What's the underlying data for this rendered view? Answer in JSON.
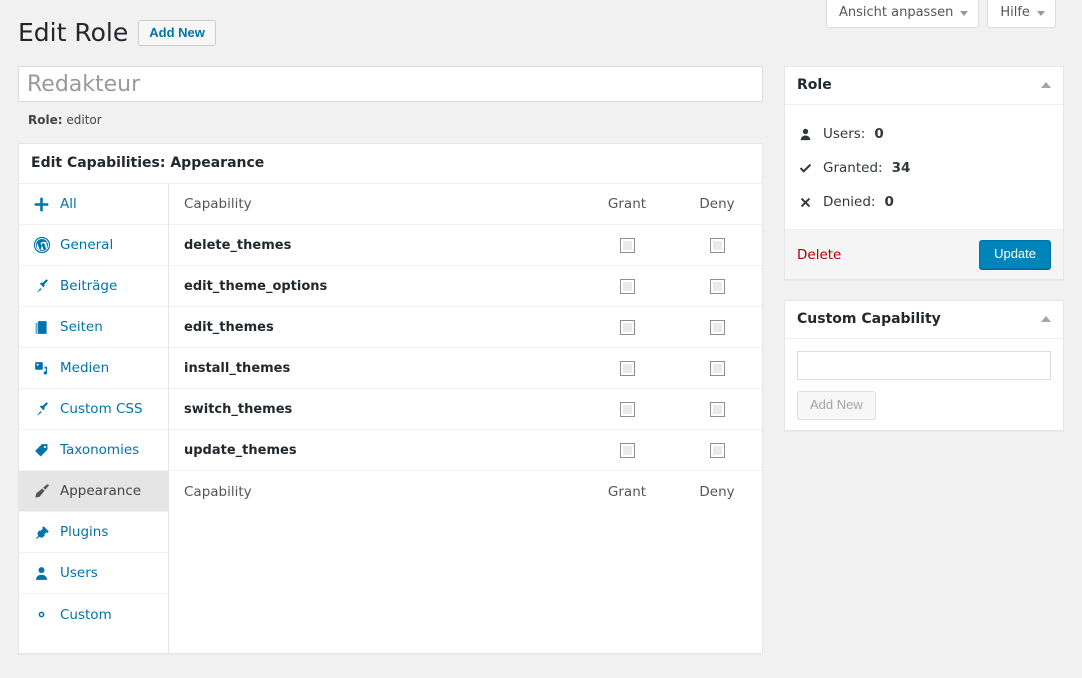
{
  "screen_meta": {
    "buttons": [
      {
        "label": "Ansicht anpassen",
        "icon": "chevron-down-icon"
      },
      {
        "label": "Hilfe",
        "icon": "chevron-down-icon"
      }
    ]
  },
  "header": {
    "title": "Edit Role",
    "add_new_label": "Add New"
  },
  "role_form": {
    "name_value": "Redakteur",
    "name_placeholder": "Redakteur",
    "slug_label": "Role:",
    "slug_value": "editor"
  },
  "capabilities_box": {
    "heading": "Edit Capabilities: Appearance",
    "nav": [
      {
        "label": "All",
        "icon": "plus-icon",
        "active": false
      },
      {
        "label": "General",
        "icon": "wordpress-icon",
        "active": false
      },
      {
        "label": "Beiträge",
        "icon": "pin-icon",
        "active": false
      },
      {
        "label": "Seiten",
        "icon": "pages-icon",
        "active": false
      },
      {
        "label": "Medien",
        "icon": "media-icon",
        "active": false
      },
      {
        "label": "Custom CSS",
        "icon": "pin-icon",
        "active": false
      },
      {
        "label": "Taxonomies",
        "icon": "tag-icon",
        "active": false
      },
      {
        "label": "Appearance",
        "icon": "brush-icon",
        "active": true
      },
      {
        "label": "Plugins",
        "icon": "plug-icon",
        "active": false
      },
      {
        "label": "Users",
        "icon": "user-icon",
        "active": false
      },
      {
        "label": "Custom",
        "icon": "gear-icon",
        "active": false
      }
    ],
    "columns": {
      "capability": "Capability",
      "grant": "Grant",
      "deny": "Deny"
    },
    "rows": [
      {
        "capability": "delete_themes",
        "grant": false,
        "deny": false
      },
      {
        "capability": "edit_theme_options",
        "grant": false,
        "deny": false
      },
      {
        "capability": "edit_themes",
        "grant": false,
        "deny": false
      },
      {
        "capability": "install_themes",
        "grant": false,
        "deny": false
      },
      {
        "capability": "switch_themes",
        "grant": false,
        "deny": false
      },
      {
        "capability": "update_themes",
        "grant": false,
        "deny": false
      }
    ]
  },
  "role_panel": {
    "title": "Role",
    "stats": [
      {
        "icon": "user-icon",
        "label": "Users:",
        "value": "0"
      },
      {
        "icon": "check-icon",
        "label": "Granted:",
        "value": "34"
      },
      {
        "icon": "cross-icon",
        "label": "Denied:",
        "value": "0"
      }
    ],
    "delete_label": "Delete",
    "update_label": "Update"
  },
  "custom_capability_panel": {
    "title": "Custom Capability",
    "input_value": "",
    "input_placeholder": "",
    "add_new_label": "Add New"
  },
  "colors": {
    "accent": "#0073aa",
    "primary_button": "#0085ba",
    "delete": "#a00",
    "page_bg": "#f1f1f1",
    "active_nav": "#e5e5e5"
  }
}
